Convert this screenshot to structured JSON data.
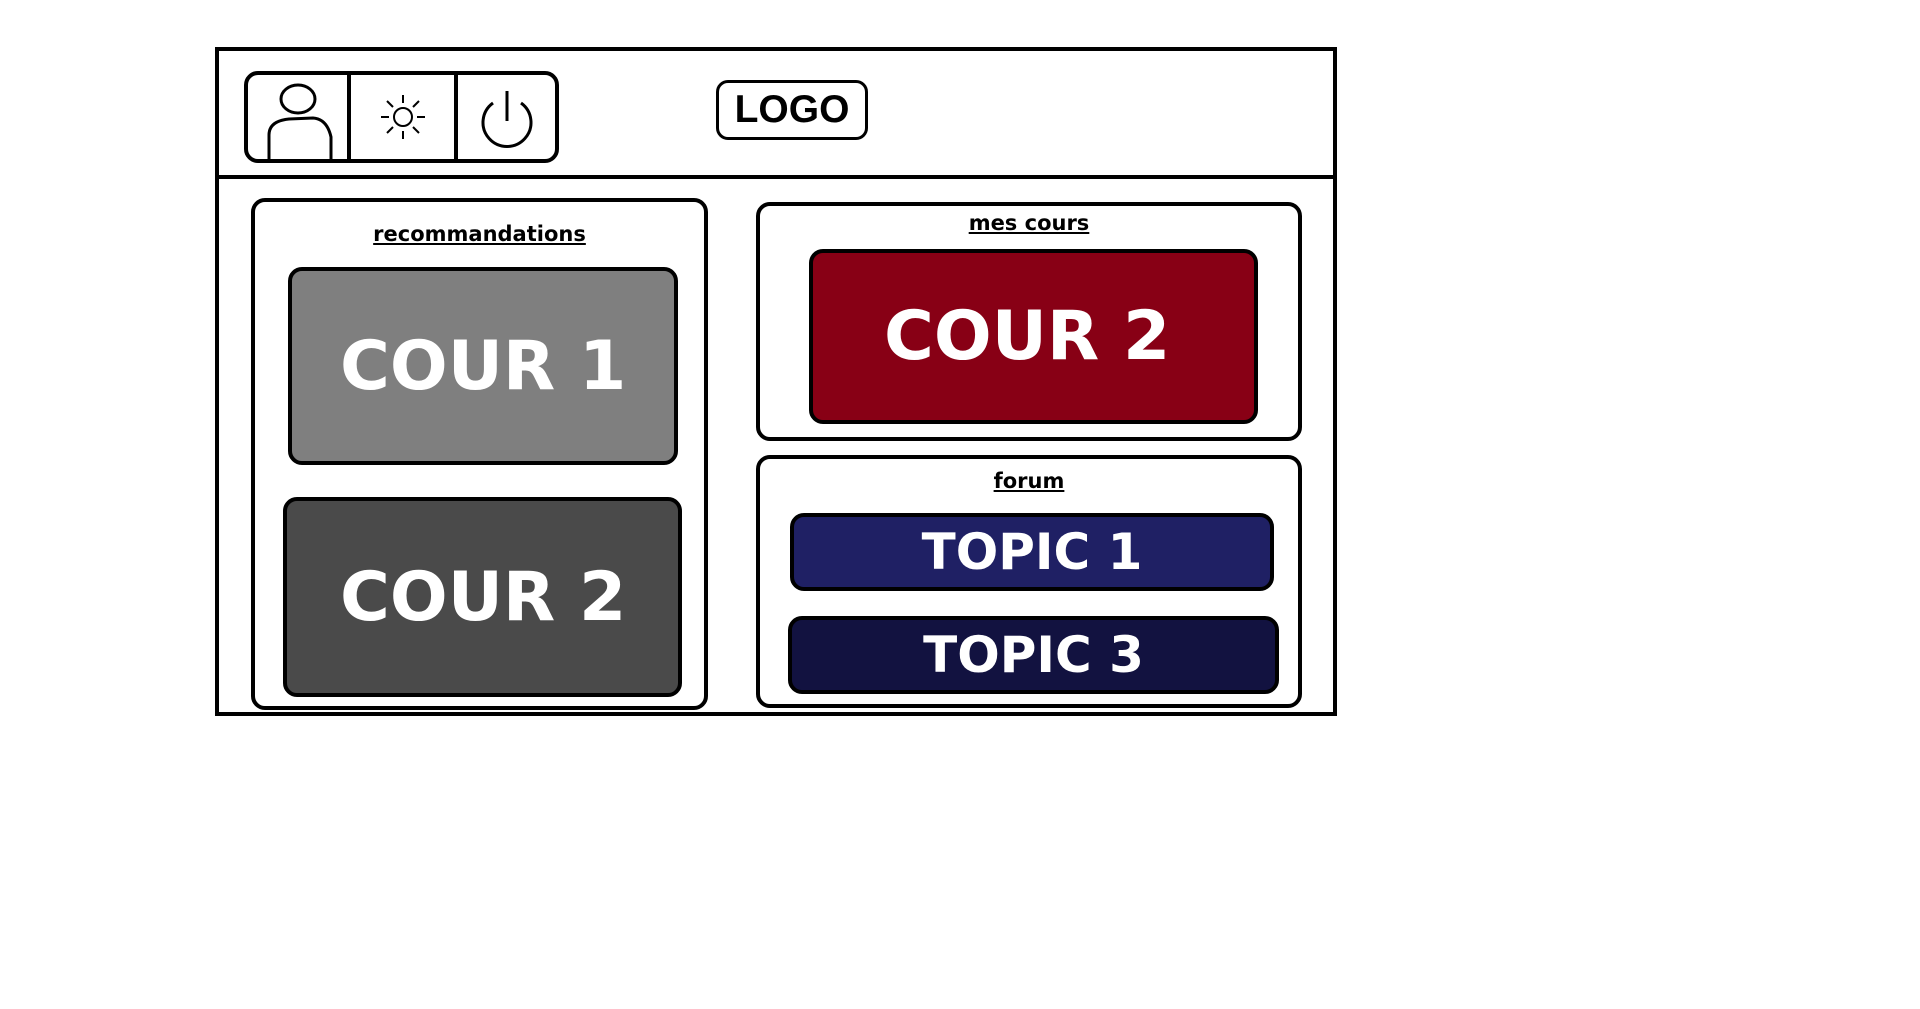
{
  "header": {
    "icons": [
      "user-icon",
      "sun-icon",
      "power-icon"
    ],
    "logo": "LOGO"
  },
  "recommandations": {
    "title": "recommandations",
    "items": [
      {
        "label": "COUR 1",
        "color": "#7f7f7f"
      },
      {
        "label": "COUR 2",
        "color": "#4a4a4a"
      }
    ]
  },
  "mes_cours": {
    "title": "mes cours",
    "items": [
      {
        "label": "COUR 2",
        "color": "#880015"
      }
    ]
  },
  "forum": {
    "title": "forum",
    "items": [
      {
        "label": "TOPIC 1",
        "color": "#1f2064"
      },
      {
        "label": "TOPIC 3",
        "color": "#121240"
      }
    ]
  }
}
